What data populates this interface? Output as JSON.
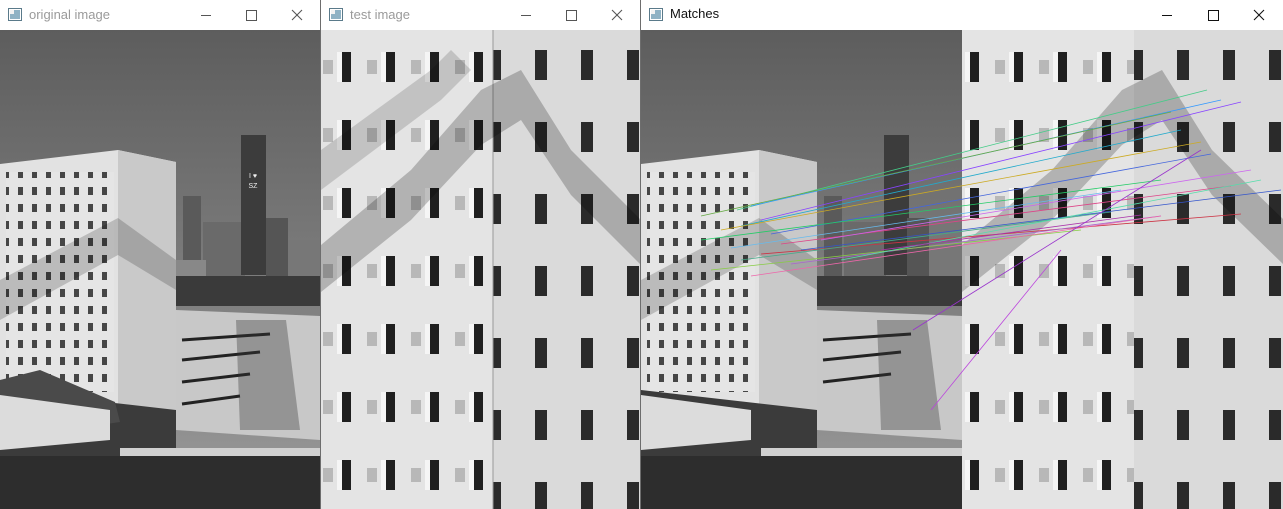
{
  "windows": [
    {
      "title": "original image",
      "active": false
    },
    {
      "title": "test image",
      "active": false
    },
    {
      "title": "Matches",
      "active": true
    }
  ],
  "icons": {
    "app": "opencv-window-icon",
    "minimize": "minimize-icon",
    "maximize": "maximize-icon",
    "close": "close-icon"
  },
  "colors": {
    "titlebar_bg": "#ffffff",
    "inactive_title": "#9a9a9a",
    "active_title": "#111111",
    "facade": "#d9d9d9",
    "sky": "#6e6e6e"
  },
  "image_text": {
    "tower_sign_line1": "I ♥",
    "tower_sign_line2": "SZ"
  }
}
